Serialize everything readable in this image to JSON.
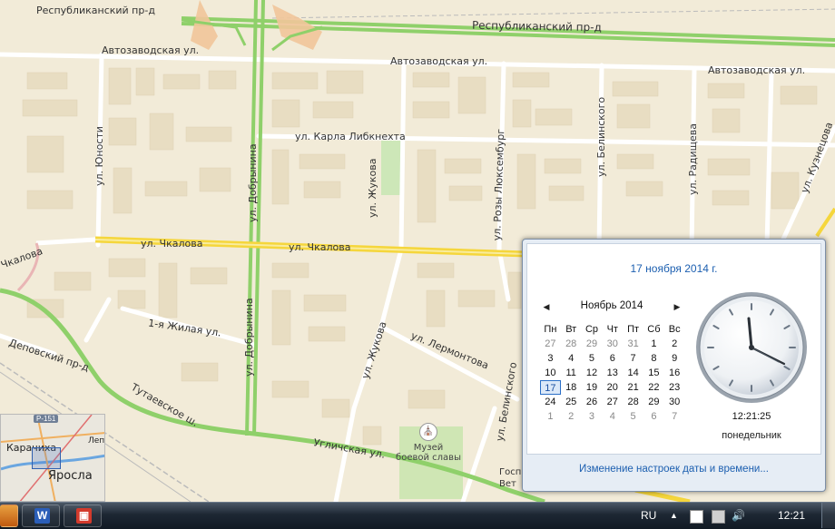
{
  "map": {
    "streets": {
      "respublikansky_top_left": "Республиканский пр-д",
      "respublikansky_top_right": "Республиканский пр-д",
      "avtozavodskaya_1": "Автозаводская ул.",
      "avtozavodskaya_2": "Автозаводская ул.",
      "avtozavodskaya_3": "Автозаводская ул.",
      "karla_libknehta": "ул. Карла Либкнехта",
      "yunosti": "ул. Юности",
      "dobrynina_top": "ул. Добрынина",
      "dobrynina_bottom": "ул. Добрынина",
      "zhukova_top": "ул. Жукова",
      "zhukova_bottom": "ул. Жукова",
      "rozy_luxemburg": "ул. Розы Люксембург",
      "belinskogo_top": "ул. Белинского",
      "belinskogo_bottom": "ул. Белинского",
      "radishcheva": "ул. Радищева",
      "kuznetsova": "ул. Кузнецова",
      "chkalova_left": "Чкалова",
      "chkalova_1": "ул. Чкалова",
      "chkalova_2": "ул. Чкалова",
      "zhilaya": "1-я Жилая ул.",
      "lermontova": "ул. Лермонтова",
      "depovsky": "Деповский пр-д",
      "tutaevskoe": "Тутаевское ш.",
      "uglichskaya": "Угличская ул.",
      "gospital_1": "Госп",
      "gospital_2": "Вет"
    },
    "poi": {
      "museum_line1": "Музей",
      "museum_line2": "боевой славы"
    },
    "minimap": {
      "road_badge": "Р-151",
      "city_small": "Карачиха",
      "city_big": "Яросла",
      "extra": "Лепо"
    }
  },
  "calendar_popup": {
    "date_link": "17 ноября 2014 г.",
    "month_title": "Ноябрь 2014",
    "weekdays": [
      "Пн",
      "Вт",
      "Ср",
      "Чт",
      "Пт",
      "Сб",
      "Вс"
    ],
    "weeks": [
      [
        "27",
        "28",
        "29",
        "30",
        "31",
        "1",
        "2"
      ],
      [
        "3",
        "4",
        "5",
        "6",
        "7",
        "8",
        "9"
      ],
      [
        "10",
        "11",
        "12",
        "13",
        "14",
        "15",
        "16"
      ],
      [
        "17",
        "18",
        "19",
        "20",
        "21",
        "22",
        "23"
      ],
      [
        "24",
        "25",
        "26",
        "27",
        "28",
        "29",
        "30"
      ],
      [
        "1",
        "2",
        "3",
        "4",
        "5",
        "6",
        "7"
      ]
    ],
    "today": "17",
    "clock_time": "12:21:25",
    "clock_day": "понедельник",
    "bottom_link": "Изменение настроек даты и времени..."
  },
  "taskbar": {
    "language": "RU",
    "time": "12:21",
    "word_icon_letter": "W"
  },
  "colors": {
    "accent_link": "#1c5fb0",
    "map_background": "#f2ebd8",
    "main_road_green": "#8fd06a",
    "chkalova_yellow": "#f5d63c"
  }
}
